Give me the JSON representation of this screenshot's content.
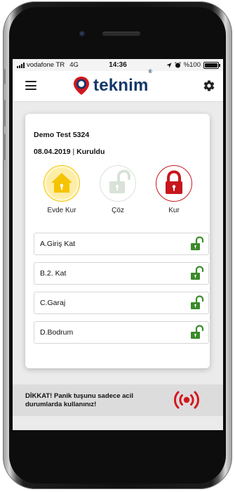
{
  "status_bar": {
    "carrier": "vodafone TR",
    "network": "4G",
    "time": "14:36",
    "battery": "%100"
  },
  "header": {
    "logo_text": "teknim",
    "logo_mark": "®",
    "logo_icon": "location-pin-icon",
    "menu_icon": "hamburger-menu-icon",
    "settings_icon": "gear-icon"
  },
  "system": {
    "name": "Demo Test 5324",
    "date": "08.04.2019",
    "separator": " | ",
    "status": "Kuruldu"
  },
  "actions": [
    {
      "label": "Evde Kur",
      "icon": "home-icon",
      "color": "#f5c400"
    },
    {
      "label": "Çöz",
      "icon": "unlock-icon",
      "color": "#d8e2d8"
    },
    {
      "label": "Kur",
      "icon": "lock-icon",
      "color": "#c8161d"
    }
  ],
  "zones": [
    {
      "label": "A.Giriş Kat",
      "icon": "unlock-icon",
      "color": "#3a8a2a"
    },
    {
      "label": "B.2. Kat",
      "icon": "unlock-icon",
      "color": "#3a8a2a"
    },
    {
      "label": "C.Garaj",
      "icon": "unlock-icon",
      "color": "#3a8a2a"
    },
    {
      "label": "D.Bodrum",
      "icon": "unlock-icon",
      "color": "#3a8a2a"
    }
  ],
  "panic": {
    "text": "DİKKAT! Panik tuşunu sadece acil durumlarda kullanınız!",
    "icon": "panic-alarm-icon",
    "color": "#d4161d"
  },
  "colors": {
    "brand_navy": "#13386b",
    "brand_red": "#d4161d"
  }
}
